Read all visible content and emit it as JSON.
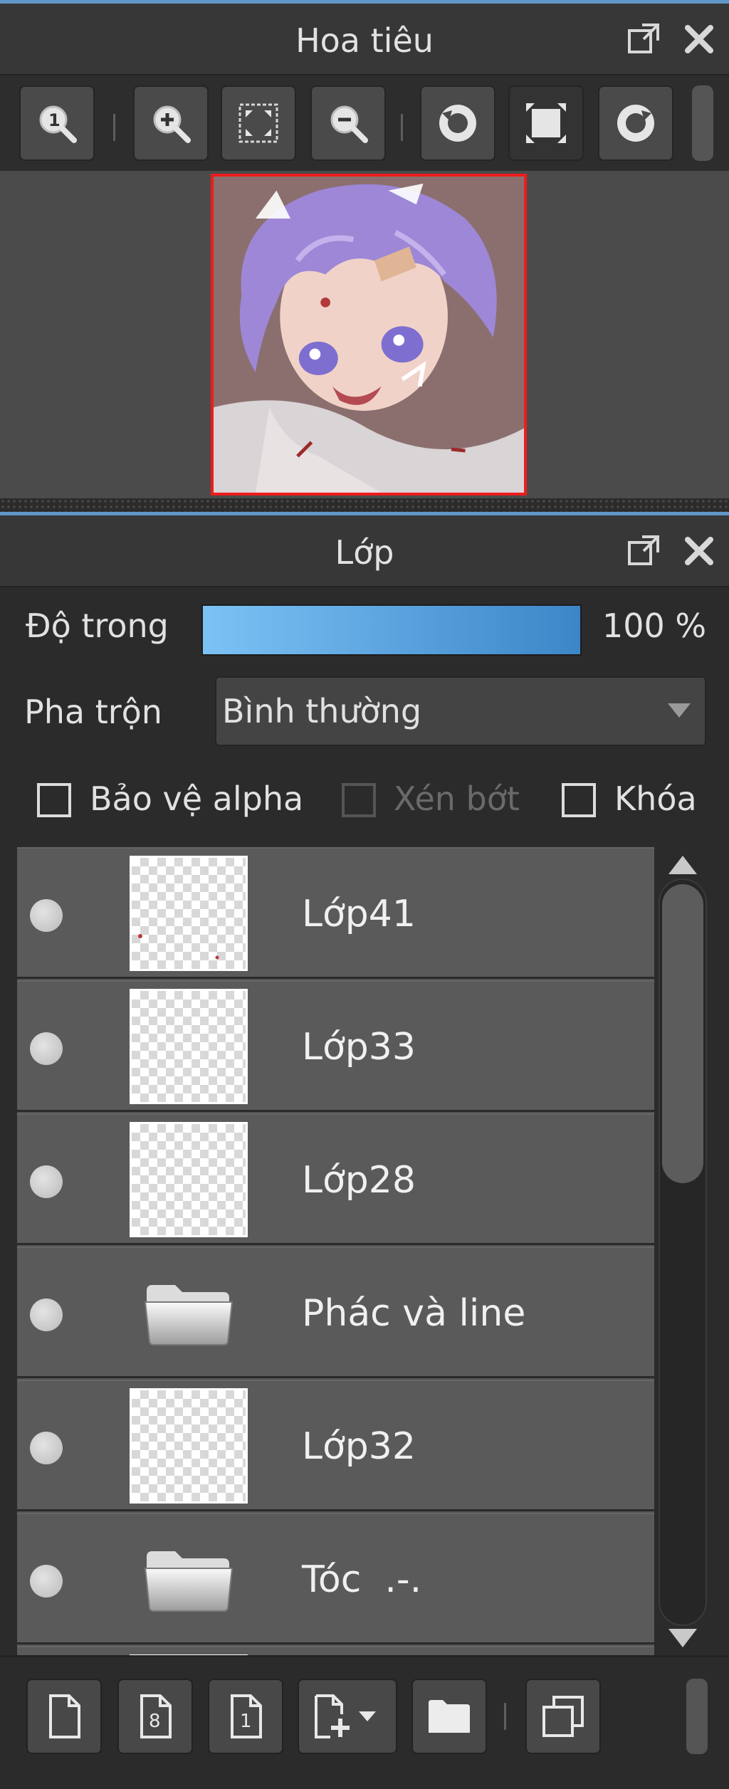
{
  "navigator": {
    "title": "Hoa tiêu",
    "icons": [
      "popout-icon",
      "close-icon"
    ],
    "toolbar": [
      "actual-size-icon",
      "zoom-in-icon",
      "fit-screen-icon",
      "zoom-out-icon",
      "rotate-left-icon",
      "fit-window-icon",
      "rotate-right-icon"
    ]
  },
  "layer_panel": {
    "title": "Lớp",
    "opacity_label": "Độ trong",
    "opacity_value": "100 %",
    "opacity_percent": 100,
    "blend_label": "Pha trộn",
    "blend_value": "Bình thường",
    "checkboxes": {
      "protect_alpha": "Bảo vệ alpha",
      "clipping": "Xén bớt",
      "lock": "Khóa"
    }
  },
  "layers": [
    {
      "name": "Lớp41",
      "type": "layer"
    },
    {
      "name": "Lớp33",
      "type": "layer"
    },
    {
      "name": "Lớp28",
      "type": "layer"
    },
    {
      "name": "Phác và line",
      "type": "folder"
    },
    {
      "name": "Lớp32",
      "type": "layer"
    },
    {
      "name": "Tóc  .-.",
      "type": "folder"
    }
  ],
  "bottom_toolbar": [
    "new-layer-icon",
    "new-8bit-layer-icon",
    "new-1bit-layer-icon",
    "add-layer-dropdown-icon",
    "new-folder-icon",
    "duplicate-layer-icon"
  ],
  "colors": {
    "accent": "#5f97c8",
    "opacity_start": "#7cc2f5",
    "opacity_end": "#3c86c8",
    "preview_border": "#ee1c1c"
  }
}
